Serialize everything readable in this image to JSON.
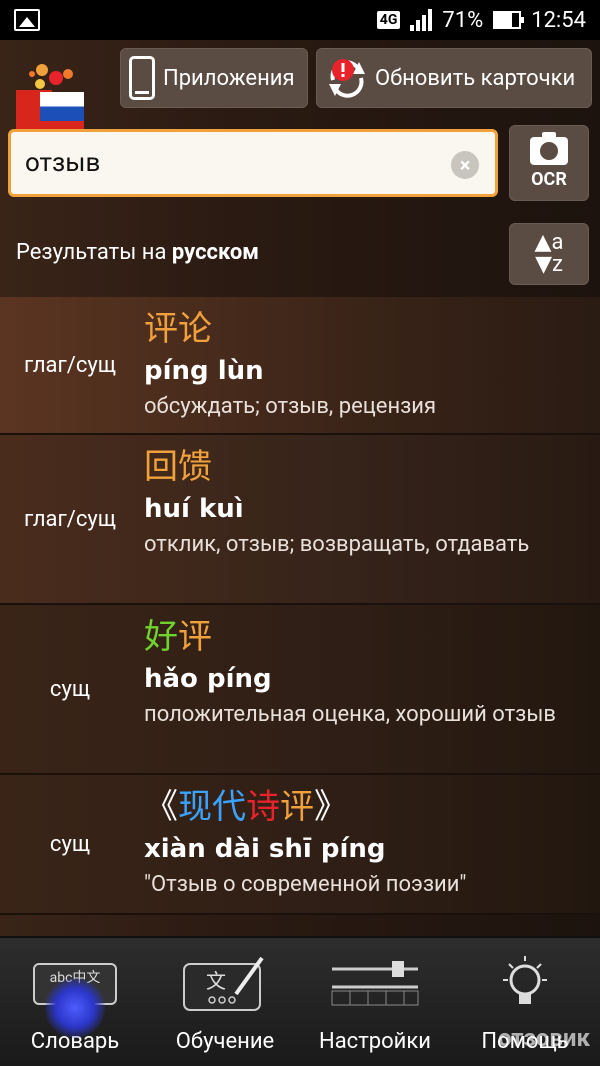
{
  "status_bar": {
    "network": "4G",
    "battery": "71%",
    "time": "12:54"
  },
  "toolbar": {
    "apps_label": "Приложения",
    "update_label": "Обновить карточки"
  },
  "search": {
    "value": "отзыв"
  },
  "ocr_label": "OCR",
  "results_header": {
    "prefix": "Результаты на ",
    "lang": "русском"
  },
  "sort": {
    "top": "a",
    "bottom": "z"
  },
  "results": [
    {
      "pos": "глаг/сущ",
      "hanzi": [
        {
          "ch": "评",
          "color": "#f0a13b"
        },
        {
          "ch": "论",
          "color": "#f0a13b"
        }
      ],
      "pinyin": "píng lùn",
      "gloss": "обсуждать; отзыв, рецензия"
    },
    {
      "pos": "глаг/сущ",
      "hanzi": [
        {
          "ch": "回",
          "color": "#f0a13b"
        },
        {
          "ch": "馈",
          "color": "#f0a13b"
        }
      ],
      "pinyin": "huí kuì",
      "gloss": "отклик, отзыв; возвращать, отдавать"
    },
    {
      "pos": "сущ",
      "hanzi": [
        {
          "ch": "好",
          "color": "#6fd32c"
        },
        {
          "ch": "评",
          "color": "#f0a13b"
        }
      ],
      "pinyin": "hǎo píng",
      "gloss": "положительная оценка, хороший отзыв"
    },
    {
      "pos": "сущ",
      "hanzi": [
        {
          "ch": "《",
          "color": "#ffffff"
        },
        {
          "ch": "现",
          "color": "#3aa3ff"
        },
        {
          "ch": "代",
          "color": "#3aa3ff"
        },
        {
          "ch": "诗",
          "color": "#e8232b"
        },
        {
          "ch": "评",
          "color": "#f0a13b"
        },
        {
          "ch": "》",
          "color": "#ffffff"
        }
      ],
      "pinyin": "xiàn dài shī píng",
      "gloss": "\"Отзыв о современной поэзии\""
    }
  ],
  "nav": {
    "dictionary": "Словарь",
    "learning": "Обучение",
    "settings": "Настройки",
    "help": "Помощь",
    "kbd_text": "abc中文"
  },
  "watermark": "отзовик"
}
